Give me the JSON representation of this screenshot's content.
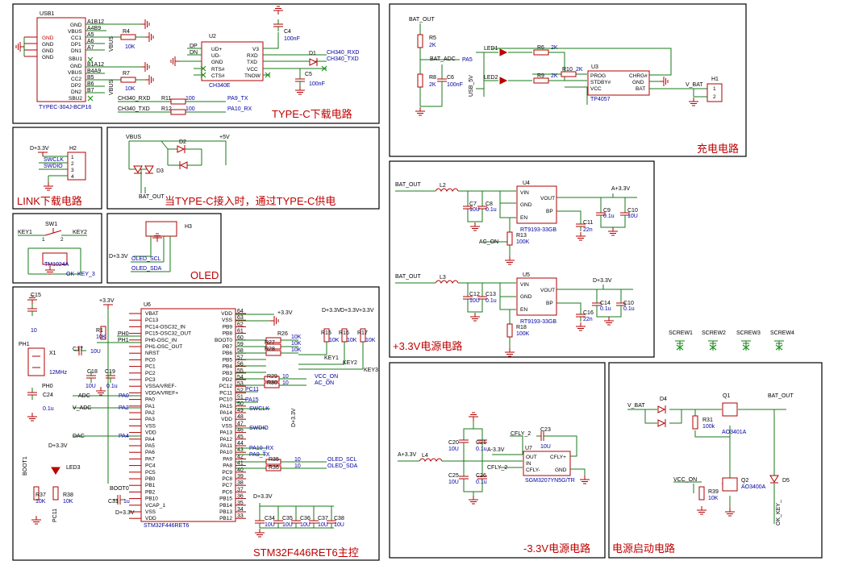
{
  "sections": {
    "typec": "TYPE-C下载电路",
    "link": "LINK下载电路",
    "power_sel": "当TYPE-C接入时，通过TYPE-C供电",
    "oled": "OLED",
    "mcu": "STM32F446RET6主控",
    "charge": "充电电路",
    "v33": "+3.3V电源电路",
    "neg33": "-3.3V电源电路",
    "power_on": "电源启动电路"
  },
  "typec": {
    "usb_ref": "USB1",
    "usb_part": "TYPEC-304J-BCP16",
    "usb_left_pins": [
      "GND",
      "GND",
      "GND",
      "GND"
    ],
    "usb_right_pins": [
      "GND",
      "VBUS",
      "CC1",
      "DP1",
      "DN1",
      "SBU1",
      "GND",
      "VBUS",
      "CC2",
      "DP2",
      "DN2",
      "SBU2"
    ],
    "usb_pin_nums": [
      "A1B12",
      "A4B9",
      "A5",
      "A6",
      "A7",
      "A8",
      "B1A12",
      "B4A9",
      "B5",
      "B6",
      "B7",
      "B8"
    ],
    "r4_ref": "R4",
    "r4_val": "10K",
    "r7_ref": "R7",
    "r7_val": "10K",
    "vbus": "VBUS",
    "u2_ref": "U2",
    "u2_part": "CH340E",
    "u2_left": [
      "UD+",
      "UD-",
      "GND",
      "RTS#",
      "CTS#"
    ],
    "u2_right": [
      "V3",
      "RXD",
      "TXD",
      "VCC",
      "TNOW"
    ],
    "net_dp": "DP",
    "net_dn": "DN",
    "c4_ref": "C4",
    "c4_val": "100nF",
    "c5_ref": "C5",
    "c5_val": "100nF",
    "d1_ref": "D1",
    "net_rxd": "CH340_RXD",
    "net_txd": "CH340_TXD",
    "r11_ref": "R11",
    "r11_val": "100",
    "r12_ref": "R12",
    "r12_val": "100",
    "net_pa9": "PA9_TX",
    "net_pa10": "PA10_RX"
  },
  "link": {
    "h2_ref": "H2",
    "pwr": "D+3.3V",
    "nets": [
      "SWCLK",
      "SWDIO"
    ],
    "pins": [
      "1",
      "2",
      "3",
      "4"
    ]
  },
  "power_sel": {
    "vbus": "VBUS",
    "p5v": "+5V",
    "d2": "D2",
    "d3": "D3",
    "bat": "BAT_OUT"
  },
  "key": {
    "sw_ref": "SW1",
    "key1": "KEY1",
    "key2": "KEY2",
    "pin1": "1",
    "pin2": "2",
    "part": "TM1024A",
    "ok": "OK",
    "key3": "KEY_3"
  },
  "oled": {
    "h3_ref": "H3",
    "pwr": "D+3.3V",
    "scl": "OLED_SCL",
    "sda": "OLED_SDA"
  },
  "mcu": {
    "u6_ref": "U6",
    "u6_part": "STM32F446RET6",
    "left_pins": [
      "VBAT",
      "PC13",
      "PC14-OSC32_IN",
      "PC15-OSC32_OUT",
      "PH0-OSC_IN",
      "PH1-OSC_OUT",
      "NRST",
      "PC0",
      "PC1",
      "PC2",
      "PC3",
      "VSSA/VREF-",
      "VDDA/VREF+",
      "PA0",
      "PA1",
      "PA2",
      "PA3",
      "VSS",
      "VDD",
      "PA4",
      "PA5",
      "PA6",
      "PA7",
      "PC4",
      "PC5",
      "PB0",
      "PB1",
      "PB2",
      "PB10",
      "VCAP_1",
      "VSS",
      "VDD"
    ],
    "right_pins": [
      "VDD",
      "VSS",
      "PB9",
      "PB8",
      "BOOT0",
      "PB7",
      "PB6",
      "PB5",
      "PB4",
      "PB3",
      "PD2",
      "PC12",
      "PC11",
      "PC10",
      "PA15",
      "PA14",
      "VDD",
      "VSS",
      "PA13",
      "PA12",
      "PA11",
      "PA10",
      "PA9",
      "PA8",
      "PC9",
      "PC8",
      "PC7",
      "PC6",
      "PB15",
      "PB14",
      "PB13",
      "PB12"
    ],
    "right_pin_nums": [
      "64",
      "63",
      "62",
      "61",
      "60",
      "59",
      "58",
      "57",
      "56",
      "55",
      "54",
      "53",
      "52",
      "51",
      "50",
      "49",
      "48",
      "47",
      "46",
      "45",
      "44",
      "43",
      "42",
      "41",
      "40",
      "39",
      "38",
      "37",
      "36",
      "35",
      "34",
      "33"
    ],
    "pwr": "+3.3V",
    "d33": "D+3.3V",
    "caps": [
      {
        "ref": "C15",
        "val": "10"
      },
      {
        "ref": "C17",
        "val": "10U"
      },
      {
        "ref": "C18",
        "val": "10U"
      },
      {
        "ref": "C19",
        "val": "0.1u"
      },
      {
        "ref": "C24",
        "val": "0.1u"
      },
      {
        "ref": "C31",
        "val": "1u"
      }
    ],
    "bottom_caps": [
      {
        "ref": "C34",
        "val": "10U"
      },
      {
        "ref": "C35",
        "val": "10U"
      },
      {
        "ref": "C36",
        "val": "10U"
      },
      {
        "ref": "C37",
        "val": "10U"
      },
      {
        "ref": "C38",
        "val": "10U"
      }
    ],
    "x1_ref": "X1",
    "x1_val": "12MHz",
    "ph0": "PH0",
    "ph1": "PH1",
    "r1_ref": "R1",
    "r1_val": "10K",
    "r26_ref": "R26",
    "r27_ref": "R27",
    "r28_ref": "R28",
    "r_val10k": "10K",
    "r29_ref": "R29",
    "r30_ref": "R30",
    "r_val10": "10",
    "r35_ref": "R35",
    "r36_ref": "R36",
    "r15_ref": "R15",
    "r16_ref": "R16",
    "r17_ref": "R17",
    "adc": "ADC",
    "v_adc": "V_ADC",
    "dac": "DAC",
    "pa0": "PA0",
    "pa2": "PA2",
    "pa4": "PA4",
    "boot0": "BOOT0",
    "boot1": "BOOT1",
    "led3": "LED3",
    "r37_ref": "R37",
    "r38_ref": "R38",
    "pc11": "PC11",
    "pa15": "PA15",
    "swclk": "SWCLK",
    "swdio": "SWDIO",
    "pa10_rx": "PA10_RX",
    "pa9_tx": "PA9_TX",
    "oled_scl": "OLED_SCL",
    "oled_sda": "OLED_SDA",
    "vcc_on": "VCC_ON",
    "ac_on": "AC_ON",
    "key1": "KEY1",
    "key2": "KEY2",
    "key3": "KEY3"
  },
  "charge": {
    "bat_out": "BAT_OUT",
    "r5": "R5",
    "r5v": "2K",
    "r8": "R8",
    "r8v": "2K",
    "c6": "C6",
    "c6v": "100nF",
    "bat_adc": "BAT_ADC",
    "pa5": "PA5",
    "usb_5v": "USB_5V",
    "led1": "LED1",
    "led2": "LED2",
    "r6": "R6",
    "r6v": "2K",
    "r9": "R9",
    "r9v": "2K",
    "r10": "R10",
    "r10v": "2K",
    "u3_ref": "U3",
    "u3_part": "TP4057",
    "u3_left": [
      "PROG",
      "STDBY#",
      "VCC"
    ],
    "u3_right": [
      "CHRG#",
      "GND",
      "BAT"
    ],
    "v_bat": "V_BAT",
    "h1_ref": "H1",
    "h1_pins": [
      "1",
      "2"
    ]
  },
  "v33": {
    "bat_out": "BAT_OUT",
    "l2": "L2",
    "l3": "L3",
    "u4_ref": "U4",
    "u5_ref": "U5",
    "part": "RT9193-33GB",
    "left": [
      "VIN",
      "GND",
      "EN"
    ],
    "right": [
      "VOUT",
      "BP"
    ],
    "pwr": "A+3.3V",
    "pwr2": "D+3.3V",
    "c7": "C7",
    "c7v": "10U",
    "c8": "C8",
    "c8v": "0.1u",
    "c9": "C9",
    "c9v": "0.1u",
    "c10": "C10",
    "c10v": "10U",
    "c11": "C11",
    "c11v": "22n",
    "c12": "C12",
    "c13": "C13",
    "c14": "C14",
    "c16": "C16",
    "c16v": "22n",
    "r13": "R13",
    "r13v": "100K",
    "r18": "R18",
    "r18v": "100K",
    "ac_on": "AC_ON",
    "dc_on": "DC_ON",
    "screws": [
      "SCREW1",
      "SCREW2",
      "SCREW3",
      "SCREW4"
    ]
  },
  "neg33": {
    "a33": "A+3.3V",
    "l4": "L4",
    "u7_ref": "U7",
    "u7_part": "SGM3207YN5G/TR",
    "left": [
      "OUT",
      "IN",
      "CFLY-"
    ],
    "right": [
      "CFLY+",
      "GND"
    ],
    "cfly2": "CFLY_2",
    "c23": "C23",
    "c23v": "10U",
    "c20": "C20",
    "c21": "C21",
    "c25": "C25",
    "c26": "C26",
    "neg": "A-3.3V"
  },
  "power_on": {
    "v_bat": "V_BAT",
    "bat_out": "BAT_OUT",
    "d4": "D4",
    "q1": "Q1",
    "q1p": "AO3401A",
    "q2": "Q2",
    "q2p": "AO3400A",
    "r31": "R31",
    "r31v": "100k",
    "r39": "R39",
    "r39v": "10K",
    "vcc_on": "VCC_ON",
    "d5": "D5",
    "ok_key": "OK_KEY_"
  }
}
